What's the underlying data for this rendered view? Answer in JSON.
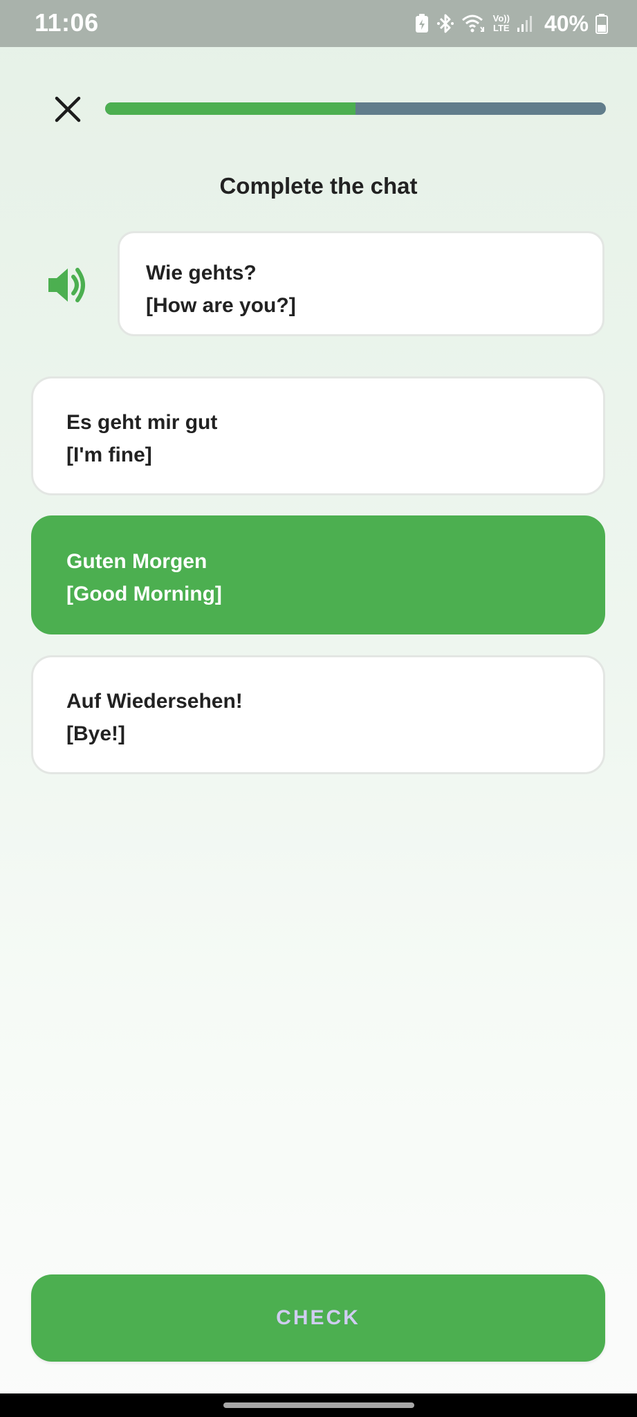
{
  "status_bar": {
    "time": "11:06",
    "battery_percent": "40%",
    "icons": [
      "battery-saver-icon",
      "bluetooth-icon",
      "wifi-icon",
      "volte-icon",
      "signal-icon",
      "battery-icon"
    ],
    "volte_label_top": "Vo))",
    "volte_label_bottom": "LTE"
  },
  "header": {
    "close_icon": "close-icon",
    "progress_fraction": 0.5,
    "progress_colors": {
      "filled": "#4caf50",
      "track": "#617d8b"
    }
  },
  "prompt": {
    "title": "Complete the chat"
  },
  "question": {
    "speaker_icon": "speaker-icon",
    "line1": "Wie gehts?",
    "line2": "[How are you?]"
  },
  "options": [
    {
      "line1": "Es geht mir gut",
      "line2": "[I'm fine]",
      "selected": false
    },
    {
      "line1": "Guten Morgen",
      "line2": "[Good Morning]",
      "selected": true
    },
    {
      "line1": "Auf Wiedersehen!",
      "line2": "[Bye!]",
      "selected": false
    }
  ],
  "check_button": {
    "label": "CHECK"
  },
  "colors": {
    "accent": "#4caf50",
    "status_bar": "#a9b2ab",
    "check_label": "#cfcdf0"
  }
}
